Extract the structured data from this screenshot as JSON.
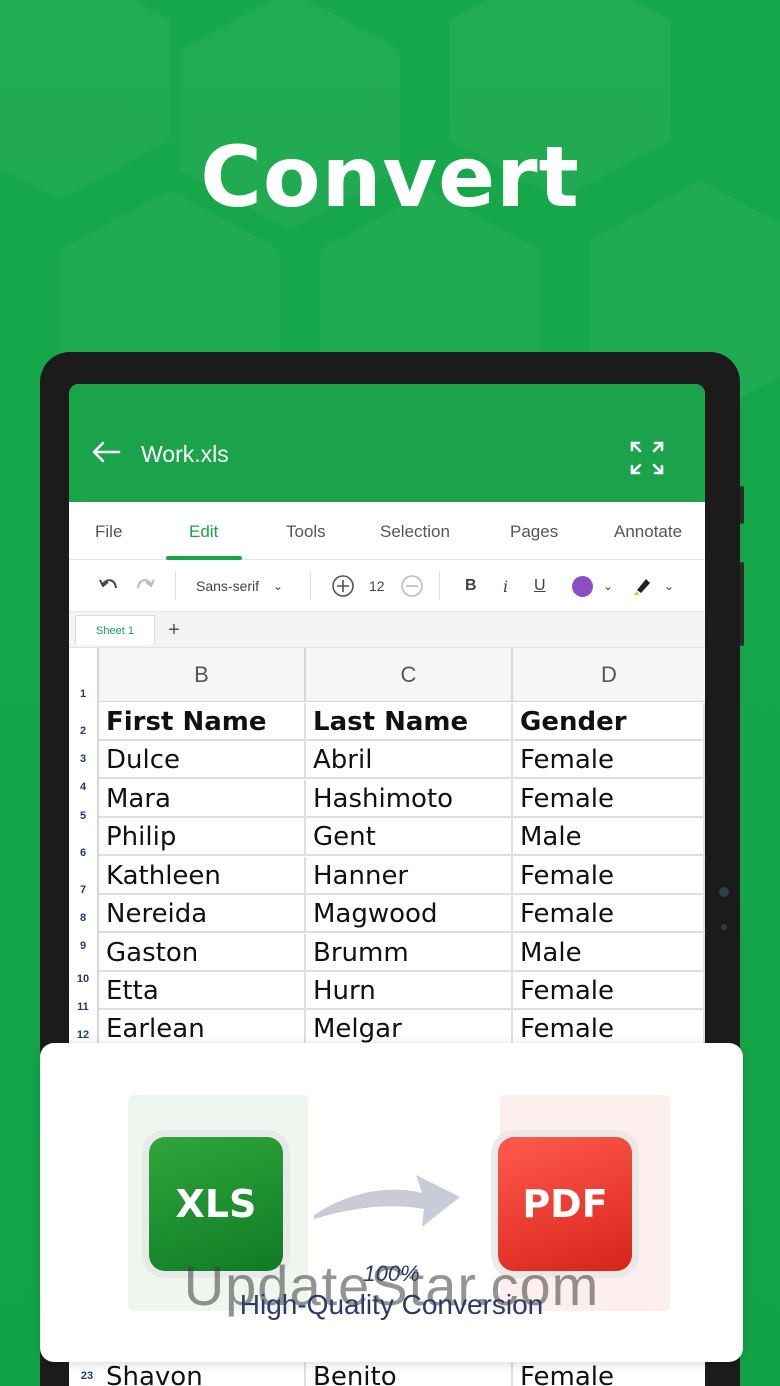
{
  "headline": "Convert",
  "app": {
    "document_title": "Work.xls",
    "menu": [
      "File",
      "Edit",
      "Tools",
      "Selection",
      "Pages",
      "Annotate"
    ],
    "active_menu": "Edit",
    "toolbar": {
      "font": "Sans-serif",
      "font_size": "12",
      "bold": "B",
      "italic": "i",
      "underline": "U",
      "text_color": "#8a4fc4"
    },
    "sheet_tab": "Sheet 1",
    "columns": [
      "B",
      "C",
      "D"
    ],
    "row_numbers": [
      "1",
      "2",
      "3",
      "4",
      "5",
      "6",
      "7",
      "8",
      "9",
      "10",
      "11",
      "12"
    ],
    "header_row": [
      "First Name",
      "Last Name",
      "Gender"
    ],
    "rows": [
      [
        "Dulce",
        "Abril",
        "Female"
      ],
      [
        "Mara",
        "Hashimoto",
        "Female"
      ],
      [
        "Philip",
        "Gent",
        "Male"
      ],
      [
        "Kathleen",
        "Hanner",
        "Female"
      ],
      [
        "Nereida",
        "Magwood",
        "Female"
      ],
      [
        "Gaston",
        "Brumm",
        "Male"
      ],
      [
        "Etta",
        "Hurn",
        "Female"
      ],
      [
        "Earlean",
        "Melgar",
        "Female"
      ]
    ],
    "last_row_number": "23",
    "last_row": [
      "Shavon",
      "Benito",
      "Female"
    ]
  },
  "card": {
    "from_format": "XLS",
    "to_format": "PDF",
    "percent": "100%",
    "caption": "High-Quality Conversion",
    "watermark": "UpdateStar.com"
  },
  "colors": {
    "brand_green": "#1aa34a",
    "pdf_red": "#e8342a",
    "caption_navy": "#2d3a66"
  }
}
